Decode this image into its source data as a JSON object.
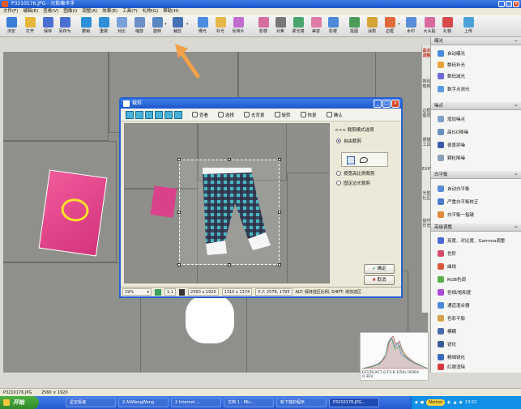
{
  "window": {
    "title": "P3210176.JPG - 光影魔术手"
  },
  "menu": [
    "文件(F)",
    "编辑(E)",
    "查看(V)",
    "图像(I)",
    "调整(A)",
    "效果(E)",
    "工具(T)",
    "礼物(G)",
    "帮助(H)"
  ],
  "toolbar": [
    {
      "label": "浏览",
      "icon": "browse-icon",
      "color": "#3a7dd8"
    },
    {
      "label": "打开",
      "icon": "open-icon",
      "color": "#e8b63a"
    },
    {
      "label": "保存",
      "icon": "save-icon",
      "color": "#4b6ed2"
    },
    {
      "label": "另存为",
      "icon": "save-as-icon",
      "color": "#4b6ed2"
    },
    {
      "label": "撤销",
      "icon": "undo-icon",
      "color": "#2c8fd8"
    },
    {
      "label": "重做",
      "icon": "redo-icon",
      "color": "#2c8fd8"
    },
    {
      "label": "对比",
      "icon": "compare-icon",
      "color": "#7aa0d8"
    },
    {
      "label": "缩放",
      "icon": "zoom-icon",
      "color": "#6b8ec8"
    },
    {
      "label": "旋转",
      "icon": "rotate-icon",
      "color": "#5a86c2"
    },
    {
      "label": "裁剪",
      "icon": "crop-icon",
      "color": "#456fb5"
    },
    {
      "label": "曝光",
      "icon": "exposure-icon",
      "color": "#4b8be0"
    },
    {
      "label": "补光",
      "icon": "fill-light-icon",
      "color": "#e6b84a"
    },
    {
      "label": "反转片",
      "icon": "reversal-film-icon",
      "color": "#c26bd1"
    },
    {
      "label": "影楼",
      "icon": "studio-icon",
      "color": "#d56c9e"
    },
    {
      "label": "对焦",
      "icon": "focus-icon",
      "color": "#777777"
    },
    {
      "label": "柔光镜",
      "icon": "soft-lens-icon",
      "color": "#4aa66e"
    },
    {
      "label": "美容",
      "icon": "beauty-icon",
      "color": "#e07aa8"
    },
    {
      "label": "影楼",
      "icon": "studio-icon-2",
      "color": "#4a8ad8"
    },
    {
      "label": "抠图",
      "icon": "cutout-icon",
      "color": "#4a9e5a"
    },
    {
      "label": "涂鸦",
      "icon": "doodle-icon",
      "color": "#d4a437"
    },
    {
      "label": "边框",
      "icon": "border-icon",
      "color": "#e26a3a"
    },
    {
      "label": "水印",
      "icon": "watermark-icon",
      "color": "#5a8fd8"
    },
    {
      "label": "大头贴",
      "icon": "sticker-icon",
      "color": "#d86aa0"
    },
    {
      "label": "礼物",
      "icon": "gift-icon",
      "color": "#d84a4a"
    },
    {
      "label": "上传",
      "icon": "upload-icon",
      "color": "#4aa0d8"
    }
  ],
  "right_panel": {
    "vertical_tabs": [
      "基本调整",
      "数码暗房",
      "边框图层",
      "便捷工具",
      "EXIF",
      "光影社区",
      "操作历史"
    ],
    "sections": [
      {
        "title": "曝光",
        "items": [
          {
            "label": "自动曝光",
            "icon": "auto-exposure-icon",
            "color": "#4a8ae0"
          },
          {
            "label": "数码补光",
            "icon": "digital-fill-icon",
            "color": "#e8a33a"
          },
          {
            "label": "数码减光",
            "icon": "digital-dim-icon",
            "color": "#6b6bd8"
          },
          {
            "label": "数字点测光",
            "icon": "spot-metering-icon",
            "color": "#5a9be0"
          }
        ]
      },
      {
        "title": "噪点",
        "items": [
          {
            "label": "增加噪点",
            "icon": "add-noise-icon",
            "color": "#7fa0c8"
          },
          {
            "label": "高ISO降噪",
            "icon": "high-iso-denoise-icon",
            "color": "#6a8fc0"
          },
          {
            "label": "夜景抑噪",
            "icon": "night-denoise-icon",
            "color": "#3a5aa8"
          },
          {
            "label": "颗粒降噪",
            "icon": "grain-denoise-icon",
            "color": "#8aa0b8"
          }
        ]
      },
      {
        "title": "白平衡",
        "items": [
          {
            "label": "自动白平衡",
            "icon": "auto-wb-icon",
            "color": "#5a8ad8"
          },
          {
            "label": "严重白平衡校正",
            "icon": "severe-wb-icon",
            "color": "#4a7ac8"
          },
          {
            "label": "白平衡一指键",
            "icon": "one-touch-wb-icon",
            "color": "#e08a3a"
          }
        ]
      },
      {
        "title": "高级调整",
        "items": [
          {
            "label": "亮度、对比度、Gamma调整",
            "icon": "brightness-icon",
            "color": "#4a6ad8"
          },
          {
            "label": "色阶",
            "icon": "levels-icon",
            "color": "#d84a6a"
          },
          {
            "label": "曲线",
            "icon": "curves-icon",
            "color": "#d85a3a"
          },
          {
            "label": "RGB色调",
            "icon": "rgb-tone-icon",
            "color": "#5ab04a"
          },
          {
            "label": "色相/饱和度",
            "icon": "hue-saturation-icon",
            "color": "#a84ad8"
          },
          {
            "label": "通道混合器",
            "icon": "channel-mixer-icon",
            "color": "#4a8ad8"
          },
          {
            "label": "色彩平衡",
            "icon": "color-balance-icon",
            "color": "#d8a04a"
          },
          {
            "label": "模糊",
            "icon": "blur-icon",
            "color": "#4a6ab0"
          },
          {
            "label": "锐化",
            "icon": "sharpen-icon",
            "color": "#3a5a98"
          },
          {
            "label": "精细锐化",
            "icon": "fine-sharpen-icon",
            "color": "#3a6ab8"
          },
          {
            "label": "红眼消除",
            "icon": "red-eye-icon",
            "color": "#d83a3a"
          }
        ]
      }
    ]
  },
  "histogram": {
    "caption_line1": "FE15S,XC7.0 F2.8 1/50s ISO64",
    "caption_line2": "0.3EV"
  },
  "statusbar": {
    "filename": "P3210176.JPG",
    "size": "2560 × 1920"
  },
  "dialog": {
    "title": "裁剪",
    "tools": [
      "查看",
      "选择",
      "去背景",
      "旋转",
      "恢复",
      "确认"
    ],
    "side_header": "<<< 裁剪模式选项",
    "options": [
      {
        "label": "自由裁剪",
        "selected": true
      },
      {
        "label": "按宽高比例裁剪",
        "selected": false
      },
      {
        "label": "固定边长裁剪",
        "selected": false
      }
    ],
    "ok": "确定",
    "cancel": "取消",
    "status": {
      "zoom": "19%",
      "ratio": "1:1",
      "image_size": "2560 x 1920",
      "crop_size": "1310 x 1374",
      "coords": "X,Y: 2578, 1795",
      "hint": "ALT: 保持选区比例, SHIFT: 增加选区"
    }
  },
  "taskbar": {
    "start": "开始",
    "items": [
      "星空极速",
      "2 AliWangWang",
      "2 Internet ...",
      "文档 1 - Mic...",
      "新下载的程序",
      "P3210176.JPG..."
    ],
    "tray": {
      "norton": "Norton",
      "clock": "13:52"
    }
  }
}
